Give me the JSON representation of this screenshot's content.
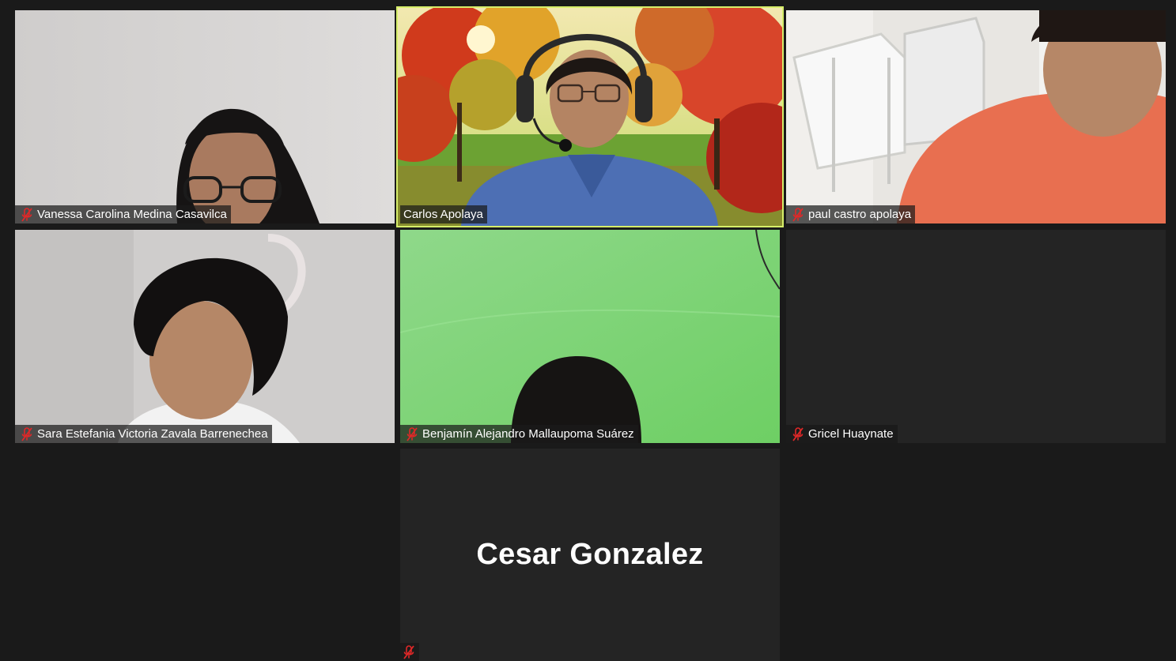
{
  "participants": [
    {
      "name": "Vanessa Carolina Medina Casavilca",
      "muted": true,
      "video": true
    },
    {
      "name": "Carlos Apolaya",
      "muted": false,
      "video": true,
      "active_speaker": true
    },
    {
      "name": "paul castro apolaya",
      "muted": true,
      "video": true
    },
    {
      "name": "Sara Estefania Victoria Zavala Barrenechea",
      "muted": true,
      "video": true
    },
    {
      "name": "Benjamín Alejandro Mallaupoma Suárez",
      "muted": true,
      "video": true
    },
    {
      "name": "Gricel Huaynate",
      "muted": true,
      "video": false
    },
    {
      "name": "Cesar Gonzalez",
      "muted": true,
      "video": false
    }
  ],
  "icons": {
    "muted_mic": "muted-mic-icon"
  },
  "colors": {
    "background": "#1a1a1a",
    "active_speaker_border": "#d6ee6a",
    "muted_icon": "#e02828"
  }
}
